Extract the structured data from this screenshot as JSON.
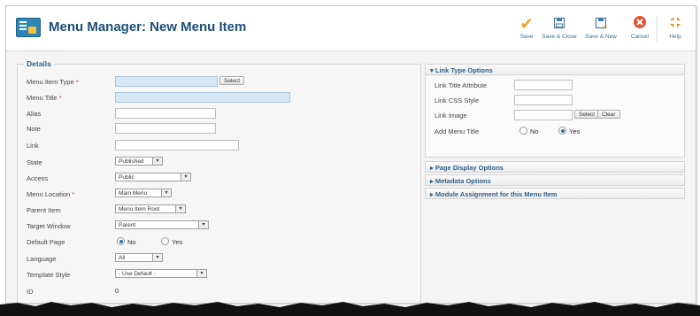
{
  "header": {
    "title": "Menu Manager: New Menu Item"
  },
  "toolbar": {
    "save": "Save",
    "save_close": "Save & Close",
    "save_new": "Save & New",
    "cancel": "Cancel",
    "help": "Help"
  },
  "details": {
    "legend": "Details",
    "menu_item_type": {
      "label": "Menu Item Type",
      "button": "Select"
    },
    "menu_title": {
      "label": "Menu Title"
    },
    "alias": {
      "label": "Alias"
    },
    "note": {
      "label": "Note"
    },
    "link": {
      "label": "Link"
    },
    "state": {
      "label": "State",
      "value": "Published"
    },
    "access": {
      "label": "Access",
      "value": "Public"
    },
    "menu_location": {
      "label": "Menu Location",
      "value": "Main Menu"
    },
    "parent_item": {
      "label": "Parent Item",
      "value": "Menu Item Root"
    },
    "target_window": {
      "label": "Target Window",
      "value": "Parent"
    },
    "default_page": {
      "label": "Default Page",
      "no": "No",
      "yes": "Yes",
      "selected": "No"
    },
    "language": {
      "label": "Language",
      "value": "All"
    },
    "template_style": {
      "label": "Template Style",
      "value": "- Use Default -"
    },
    "id": {
      "label": "ID",
      "value": "0"
    }
  },
  "link_type_options": {
    "title": "Link Type Options",
    "link_title_attribute": "Link Title Attribute",
    "link_css_style": "Link CSS Style",
    "link_image": "Link Image",
    "select_button": "Select",
    "clear_button": "Clear",
    "add_menu_title": "Add Menu Title",
    "no": "No",
    "yes": "Yes",
    "selected": "Yes"
  },
  "panels": {
    "page_display": "Page Display Options",
    "metadata": "Metadata Options",
    "module_assignment": "Module Assignment for this Menu Item"
  },
  "icons": {
    "save": "check-icon",
    "save_close": "save-close-icon",
    "save_new": "save-new-icon",
    "cancel": "cancel-icon",
    "help": "help-icon"
  },
  "colors": {
    "title": "#1b4f78",
    "required": "#d23b3b",
    "highlight_field": "#d6e8f5",
    "save_check": "#f0a12a",
    "cancel": "#e0552b"
  }
}
